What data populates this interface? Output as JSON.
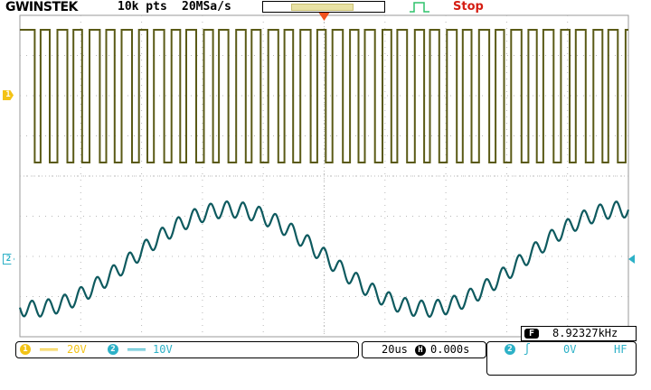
{
  "header": {
    "brand": "GWINSTEK",
    "record_length": "10k pts",
    "sample_rate": "20MSa/s",
    "run_status": "Stop",
    "trigger_icon": "pulse-trigger-icon"
  },
  "channels": {
    "ch1": {
      "marker": "1",
      "coupling_icon": "dc-coupling-icon",
      "coupling": "═══",
      "scale": "20V",
      "color": "#f3c316",
      "trace_color": "#5a5a16"
    },
    "ch2": {
      "marker": "2",
      "coupling_icon": "dc-coupling-icon",
      "coupling": "═══",
      "scale": "10V",
      "color": "#2db1c7",
      "trace_color": "#0e5a5f"
    }
  },
  "timebase": {
    "scale": "20us",
    "h_icon": "H",
    "position": "0.000s"
  },
  "trigger": {
    "source": "2",
    "edge_icon": "rising-edge-icon",
    "edge": "ʃ",
    "level": "0V",
    "coupling": "HF",
    "marker_color": "#f0521e"
  },
  "measurement": {
    "label": "F",
    "value": "8.92327kHz"
  }
}
